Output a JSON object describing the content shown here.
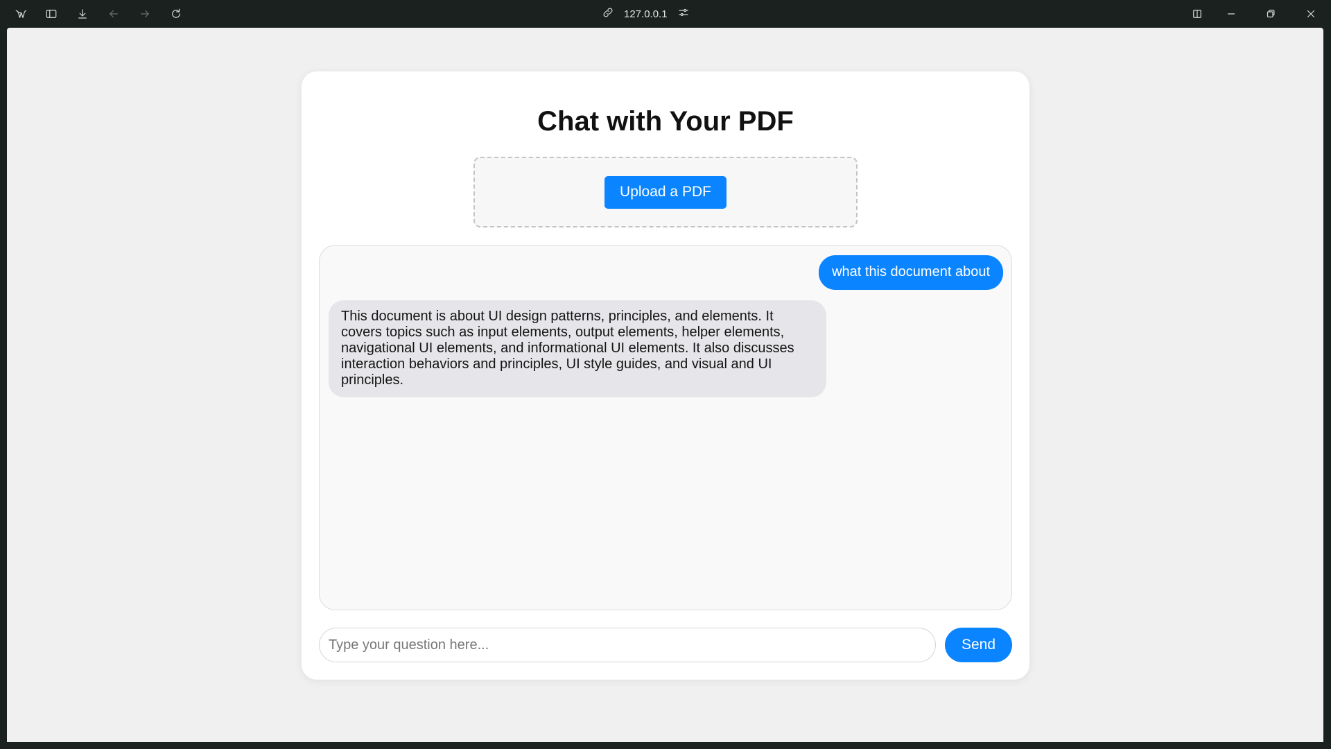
{
  "browser": {
    "address": "127.0.0.1",
    "icons": [
      "browser-logo-icon",
      "sidebar-icon",
      "download-icon",
      "back-icon",
      "forward-icon",
      "reload-icon",
      "link-icon",
      "site-settings-icon",
      "split-view-icon",
      "minimize-icon",
      "restore-icon",
      "close-icon"
    ]
  },
  "page": {
    "title": "Chat with Your PDF",
    "upload_label": "Upload a PDF"
  },
  "chat": {
    "messages": [
      {
        "role": "user",
        "text": "what this document about"
      },
      {
        "role": "assistant",
        "text": "This document is about UI design patterns, principles, and elements. It covers topics such as input elements, output elements, helper elements, navigational UI elements, and informational UI elements. It also discusses interaction behaviors and principles, UI style guides, and visual and UI principles."
      }
    ]
  },
  "composer": {
    "placeholder": "Type your question here...",
    "value": "",
    "send_label": "Send"
  },
  "colors": {
    "accent": "#0a84ff",
    "bot_bubble": "#e6e6ea",
    "page_bg": "#f0f0f0",
    "chrome_bg": "#1b211f"
  }
}
